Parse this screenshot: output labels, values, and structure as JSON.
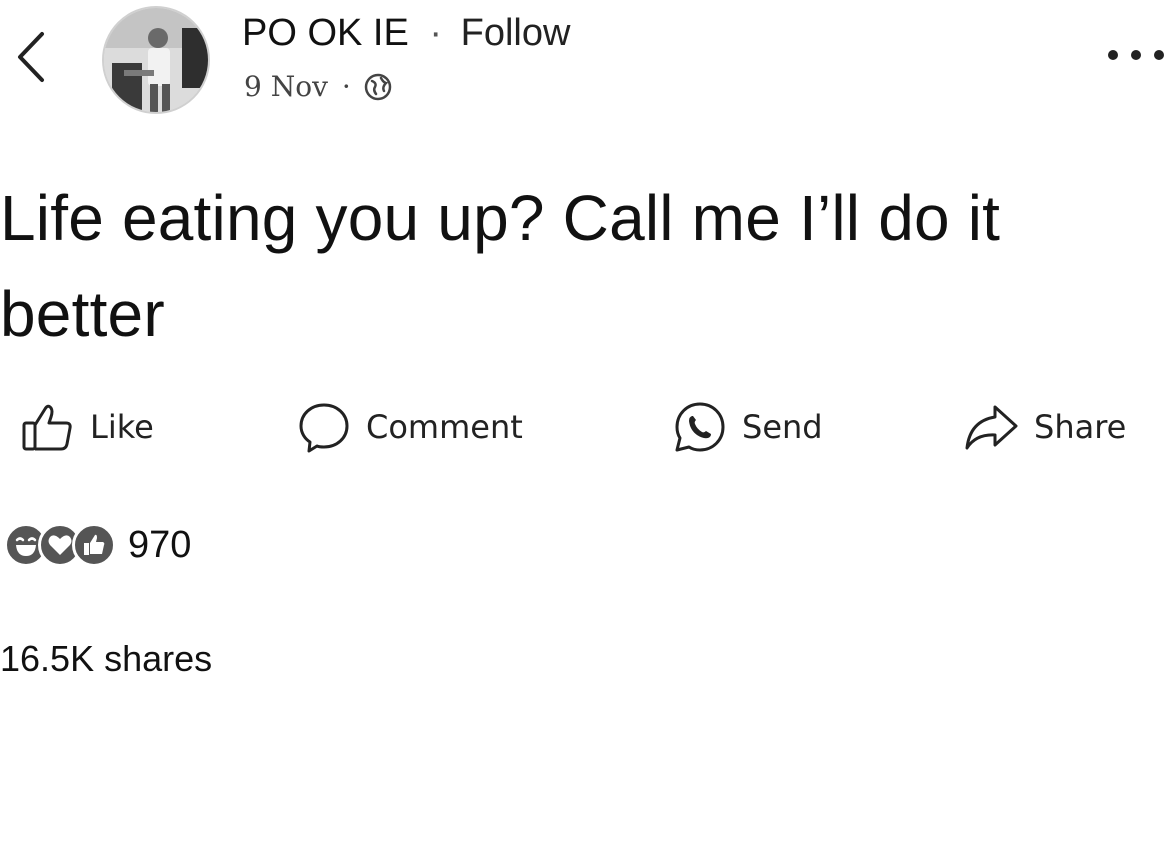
{
  "header": {
    "author_name": "PO OK IE",
    "separator": "·",
    "follow_label": "Follow",
    "date": "9 Nov",
    "meta_separator": "·",
    "privacy_icon": "globe-icon",
    "more_icon": "more-options-icon",
    "back_icon": "chevron-left-icon"
  },
  "post": {
    "text": "Life eating you up? Call me I’ll do it better"
  },
  "actions": {
    "like_label": "Like",
    "comment_label": "Comment",
    "send_label": "Send",
    "share_label": "Share"
  },
  "engagement": {
    "reaction_icons": [
      "haha-reaction-icon",
      "love-reaction-icon",
      "like-reaction-icon"
    ],
    "reaction_count": "970",
    "shares_text": "16.5K shares"
  },
  "colors": {
    "text": "#111111",
    "background": "#ffffff",
    "reaction_fill": "#555555"
  }
}
